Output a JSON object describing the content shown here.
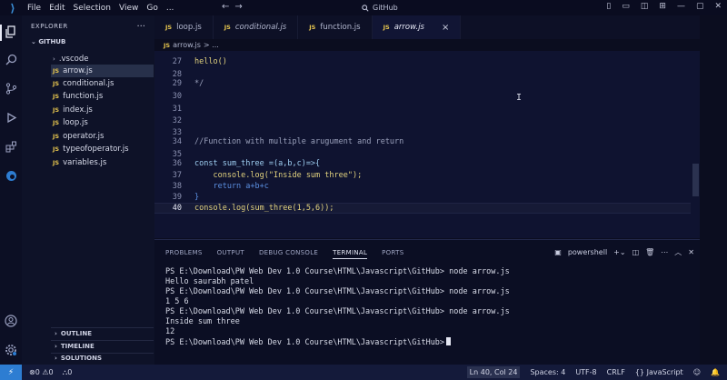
{
  "titlebar": {
    "menu": [
      "File",
      "Edit",
      "Selection",
      "View",
      "Go",
      "..."
    ],
    "search": "GitHub"
  },
  "sidebar": {
    "header": "EXPLORER",
    "dots": "...",
    "folder": "GITHUB",
    "items": [
      {
        "label": ".vscode",
        "type": "folder"
      },
      {
        "label": "arrow.js",
        "type": "js",
        "selected": true
      },
      {
        "label": "conditional.js",
        "type": "js"
      },
      {
        "label": "function.js",
        "type": "js"
      },
      {
        "label": "index.js",
        "type": "js"
      },
      {
        "label": "loop.js",
        "type": "js"
      },
      {
        "label": "operator.js",
        "type": "js"
      },
      {
        "label": "typeofoperator.js",
        "type": "js"
      },
      {
        "label": "variables.js",
        "type": "js"
      }
    ],
    "sections": [
      "OUTLINE",
      "TIMELINE",
      "SOLUTIONS"
    ]
  },
  "tabs": [
    {
      "label": "loop.js",
      "italic": false
    },
    {
      "label": "conditional.js",
      "italic": true
    },
    {
      "label": "function.js",
      "italic": false
    },
    {
      "label": "arrow.js",
      "italic": true,
      "active": true
    }
  ],
  "tab_close": "×",
  "breadcrumb": {
    "file": "arrow.js",
    "rest": "> ..."
  },
  "editor": {
    "lines": [
      {
        "n": "27",
        "text": "hello()"
      },
      {
        "n": "28",
        "text": ""
      },
      {
        "n": "29",
        "text": "*/"
      },
      {
        "n": "30",
        "text": ""
      },
      {
        "n": "31",
        "text": ""
      },
      {
        "n": "32",
        "text": ""
      },
      {
        "n": "33",
        "text": ""
      },
      {
        "n": "34",
        "text": "//Function with multiple arugument and return"
      },
      {
        "n": "35",
        "text": ""
      },
      {
        "n": "36",
        "text": "const sum_three =(a,b,c)=>{"
      },
      {
        "n": "37",
        "text": "    console.log(\"Inside sum three\");"
      },
      {
        "n": "38",
        "text": "    return a+b+c"
      },
      {
        "n": "39",
        "text": "}"
      },
      {
        "n": "40",
        "text": "console.log(sum_three(1,5,6));"
      }
    ]
  },
  "panel": {
    "tabs": [
      "PROBLEMS",
      "OUTPUT",
      "DEBUG CONSOLE",
      "TERMINAL",
      "PORTS"
    ],
    "active_tab": "TERMINAL",
    "shell": "powershell",
    "terminal": [
      "PS E:\\Download\\PW Web Dev 1.0 Course\\HTML\\Javascript\\GitHub> node arrow.js",
      "Hello saurabh patel",
      "PS E:\\Download\\PW Web Dev 1.0 Course\\HTML\\Javascript\\GitHub> node arrow.js",
      "1 5 6",
      "PS E:\\Download\\PW Web Dev 1.0 Course\\HTML\\Javascript\\GitHub> node arrow.js",
      "Inside sum three",
      "12",
      "PS E:\\Download\\PW Web Dev 1.0 Course\\HTML\\Javascript\\GitHub>"
    ]
  },
  "statusbar": {
    "errors": "0",
    "warnings": "0",
    "ports": "0",
    "position": "Ln 40, Col 24",
    "spaces": "Spaces: 4",
    "encoding": "UTF-8",
    "eol": "CRLF",
    "language": "JavaScript"
  },
  "colors": {
    "accent": "#2d7dd2",
    "editor_bg": "#0f1330",
    "js_icon": "#e7c64f"
  }
}
